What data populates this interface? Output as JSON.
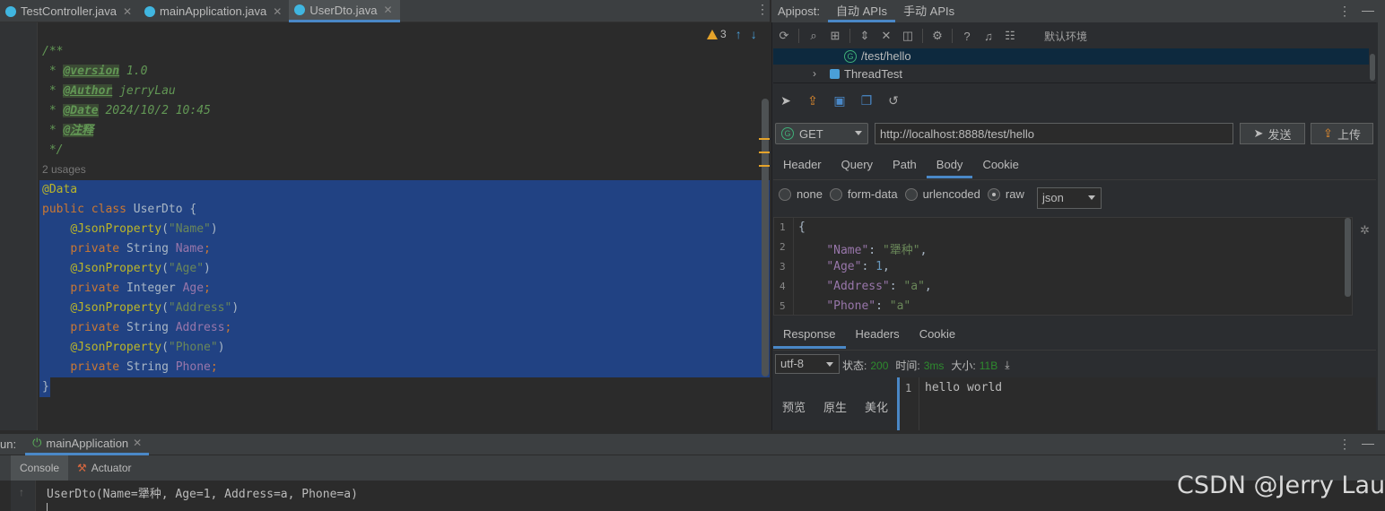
{
  "editor_tabs": [
    {
      "label": "TestController.java",
      "active": false
    },
    {
      "label": "mainApplication.java",
      "active": false
    },
    {
      "label": "UserDto.java",
      "active": true
    }
  ],
  "inspections": {
    "warnings": "3"
  },
  "editor": {
    "usages": "2 usages",
    "comment": {
      "open": "/**",
      "version_tag": "@version",
      "version": " 1.0",
      "author_tag": "@Author",
      "author": " jerryLau",
      "date_tag": "@Date",
      "date": " 2024/10/2 10:45",
      "note_tag": "@注释",
      "close": "*/"
    },
    "code": {
      "annotation": "@Data",
      "class_kw": "public class",
      "class_name": " UserDto {",
      "json_prop": "@JsonProperty",
      "private_kw": "private",
      "fields": [
        {
          "key": "\"Name\"",
          "type": "String",
          "name": "Name"
        },
        {
          "key": "\"Age\"",
          "type": "Integer",
          "name": "Age"
        },
        {
          "key": "\"Address\"",
          "type": "String",
          "name": "Address"
        },
        {
          "key": "\"Phone\"",
          "type": "String",
          "name": "Phone"
        }
      ],
      "close_brace": "}"
    }
  },
  "apipost": {
    "title": "Apipost:",
    "tabs": [
      "自动 APIs",
      "手动 APIs"
    ],
    "env": "默认环境",
    "tree": [
      {
        "badge": "G",
        "label": "/test/hello"
      },
      {
        "label": "ThreadTest"
      }
    ],
    "method": "GET",
    "method_badge": "G",
    "url": "http://localhost:8888/test/hello",
    "send": "发送",
    "upload": "上传",
    "req_tabs": [
      "Header",
      "Query",
      "Path",
      "Body",
      "Cookie"
    ],
    "body_types": [
      "none",
      "form-data",
      "urlencoded",
      "raw"
    ],
    "body_format": "json",
    "body_lines": [
      {
        "n": "1",
        "text": "{"
      },
      {
        "n": "2",
        "key": "\"Name\"",
        "val": "\"犟种\""
      },
      {
        "n": "3",
        "key": "\"Age\"",
        "val": "1"
      },
      {
        "n": "4",
        "key": "\"Address\"",
        "val": "\"a\""
      },
      {
        "n": "5",
        "key": "\"Phone\"",
        "val": "\"a\""
      }
    ],
    "resp_tabs": [
      "Response",
      "Headers",
      "Cookie"
    ],
    "encoding": "utf-8",
    "status_label": "状态:",
    "status_value": "200",
    "time_label": "时间:",
    "time_value": "3ms",
    "size_label": "大小:",
    "size_value": "11B",
    "view_modes": [
      "预览",
      "原生",
      "美化"
    ],
    "resp_line_no": "1",
    "resp_body": "hello world"
  },
  "run": {
    "label": "un:",
    "config": "mainApplication",
    "tabs": [
      "Console",
      "Actuator"
    ],
    "output": "UserDto(Name=犟种, Age=1, Address=a, Phone=a)"
  },
  "watermark": "CSDN @Jerry Lau"
}
